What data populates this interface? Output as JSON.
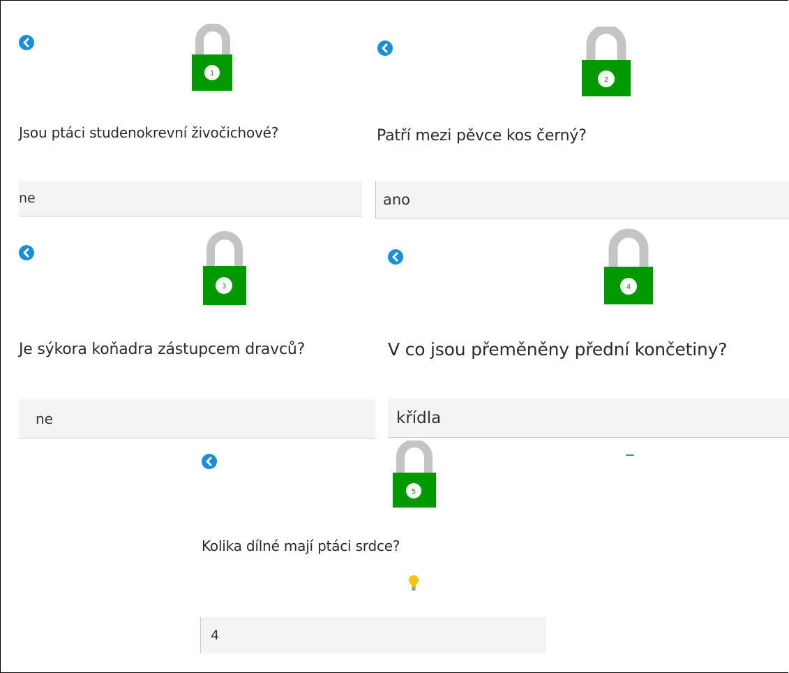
{
  "colors": {
    "back_button": "#1b8fd6",
    "lock_body": "#009a00",
    "lock_shackle": "#c4c4c4",
    "answer_bg": "#f4f4f4",
    "hint_bulb": "#f3c400"
  },
  "cards": [
    {
      "number": "1",
      "question": "Jsou ptáci studenokrevní živočichové?",
      "answer": "ne"
    },
    {
      "number": "2",
      "question": "Patří mezi pěvce kos černý?",
      "answer": "ano"
    },
    {
      "number": "3",
      "question": "Je sýkora koňadra zástupcem dravců?",
      "answer": "ne"
    },
    {
      "number": "4",
      "question": "V co jsou přeměněny přední končetiny?",
      "answer": "křídla"
    },
    {
      "number": "5",
      "question": "Kolika dílné mají ptáci srdce?",
      "answer": "4"
    }
  ],
  "icons": {
    "back": "chevron-left-circle-icon",
    "lock": "open-padlock-icon",
    "hint": "lightbulb-icon"
  }
}
